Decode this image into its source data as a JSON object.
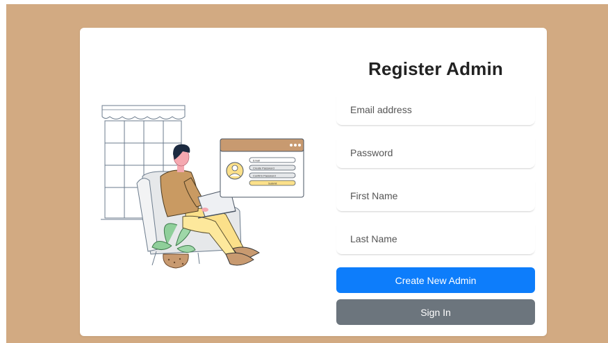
{
  "page": {
    "background": "#d2aa82"
  },
  "form": {
    "title": "Register Admin",
    "fields": [
      {
        "name": "email",
        "placeholder": "Email address",
        "value": ""
      },
      {
        "name": "password",
        "placeholder": "Password",
        "value": ""
      },
      {
        "name": "first_name",
        "placeholder": "First Name",
        "value": ""
      },
      {
        "name": "last_name",
        "placeholder": "Last Name",
        "value": ""
      }
    ],
    "primary_button": {
      "label": "Create New Admin",
      "color": "#0d7dfb"
    },
    "secondary_button": {
      "label": "Sign In",
      "color": "#6c757d"
    }
  },
  "illustration": {
    "login_window_labels": [
      "Email",
      "Create Password",
      "Confirm Password",
      "Submit"
    ],
    "icon": "person-at-laptop-illustration"
  }
}
